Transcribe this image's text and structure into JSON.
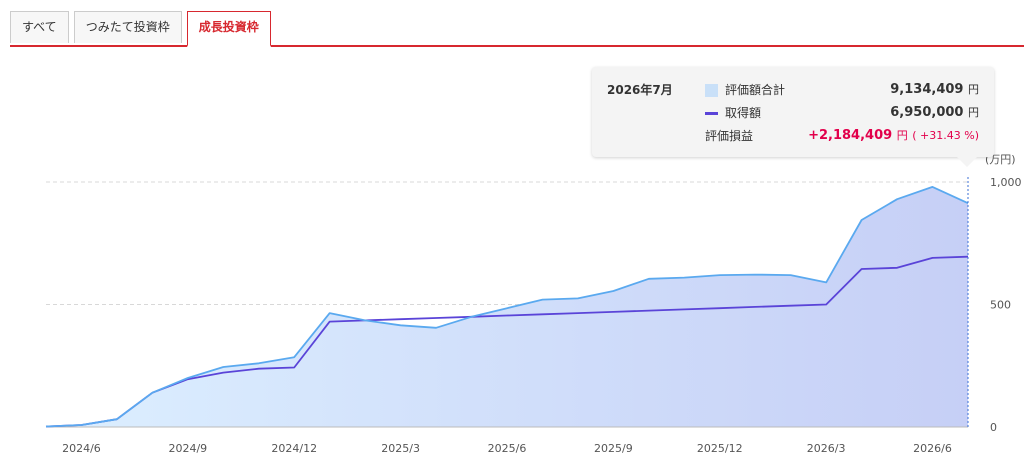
{
  "tabs": [
    {
      "label": "すべて",
      "active": false
    },
    {
      "label": "つみたて投資枠",
      "active": false
    },
    {
      "label": "成長投資枠",
      "active": true
    }
  ],
  "tooltip": {
    "date": "2026年7月",
    "rows": [
      {
        "label": "評価額合計",
        "value": "9,134,409",
        "unit": "円"
      },
      {
        "label": "取得額",
        "value": "6,950,000",
        "unit": "円"
      },
      {
        "label": "評価損益",
        "value": "+2,184,409",
        "unit": "円",
        "pct": "( +31.43 %)"
      }
    ]
  },
  "colors": {
    "accent": "#d7282f",
    "valuation_line": "#5aa9ef",
    "valuation_fill": "#c9e0f8",
    "acquisition_line": "#5a44d8",
    "profit": "#e2004b"
  },
  "chart_data": {
    "type": "area",
    "unit_label": "(万円)",
    "ylim": [
      0,
      1000
    ],
    "yticks": [
      {
        "value": 1000,
        "label": "1,000"
      },
      {
        "value": 500,
        "label": "500"
      },
      {
        "value": 0,
        "label": "0"
      }
    ],
    "x_tick_labels": [
      "2024/6",
      "2024/9",
      "2024/12",
      "2025/3",
      "2025/6",
      "2025/9",
      "2025/12",
      "2026/3",
      "2026/6"
    ],
    "x": [
      "2024/5",
      "2024/6",
      "2024/7",
      "2024/8",
      "2024/9",
      "2024/10",
      "2024/11",
      "2024/12",
      "2025/1",
      "2025/2",
      "2025/3",
      "2025/4",
      "2025/5",
      "2025/6",
      "2025/7",
      "2025/8",
      "2025/9",
      "2025/10",
      "2025/11",
      "2025/12",
      "2026/1",
      "2026/2",
      "2026/3",
      "2026/4",
      "2026/5",
      "2026/6",
      "2026/7"
    ],
    "series": [
      {
        "name": "評価額合計",
        "values": [
          2,
          8,
          32,
          140,
          200,
          245,
          260,
          285,
          465,
          435,
          415,
          405,
          450,
          485,
          520,
          525,
          555,
          605,
          610,
          620,
          622,
          620,
          590,
          845,
          930,
          980,
          913.4
        ]
      },
      {
        "name": "取得額",
        "values": [
          2,
          8,
          32,
          140,
          195,
          222,
          238,
          243,
          430,
          435,
          440,
          445,
          450,
          455,
          460,
          465,
          470,
          475,
          480,
          485,
          490,
          495,
          500,
          645,
          650,
          690,
          695
        ]
      }
    ],
    "grid": true,
    "hover_index": 26
  }
}
